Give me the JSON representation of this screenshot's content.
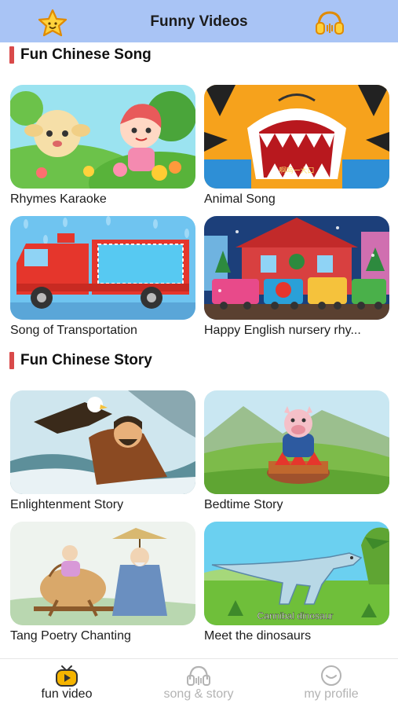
{
  "header": {
    "title": "Funny Videos",
    "left_icon": "star-icon",
    "right_icon": "headphones-icon"
  },
  "sections": [
    {
      "title": "Fun Chinese Song",
      "items": [
        {
          "label": "Rhymes Karaoke"
        },
        {
          "label": "Animal Song"
        },
        {
          "label": "Song of Transportation"
        },
        {
          "label": "Happy English nursery rhy..."
        }
      ]
    },
    {
      "title": "Fun Chinese Story",
      "items": [
        {
          "label": "Enlightenment Story"
        },
        {
          "label": "Bedtime Story"
        },
        {
          "label": "Tang Poetry Chanting"
        },
        {
          "label": "Meet the dinosaurs",
          "overlay": "Cannibal dinosaur"
        }
      ]
    }
  ],
  "thumb_text": {
    "animal_song_caption": "啊呜一大口"
  },
  "bottom_nav": [
    {
      "label": "fun video",
      "icon": "tv-icon",
      "active": true
    },
    {
      "label": "song & story",
      "icon": "headphones-icon",
      "active": false
    },
    {
      "label": "my profile",
      "icon": "smile-face-icon",
      "active": false
    }
  ],
  "colors": {
    "header_bg": "#a9c4f5",
    "section_accent": "#d94a4a",
    "nav_active_icon": "#f5b400",
    "nav_inactive": "#b3b3b3"
  }
}
